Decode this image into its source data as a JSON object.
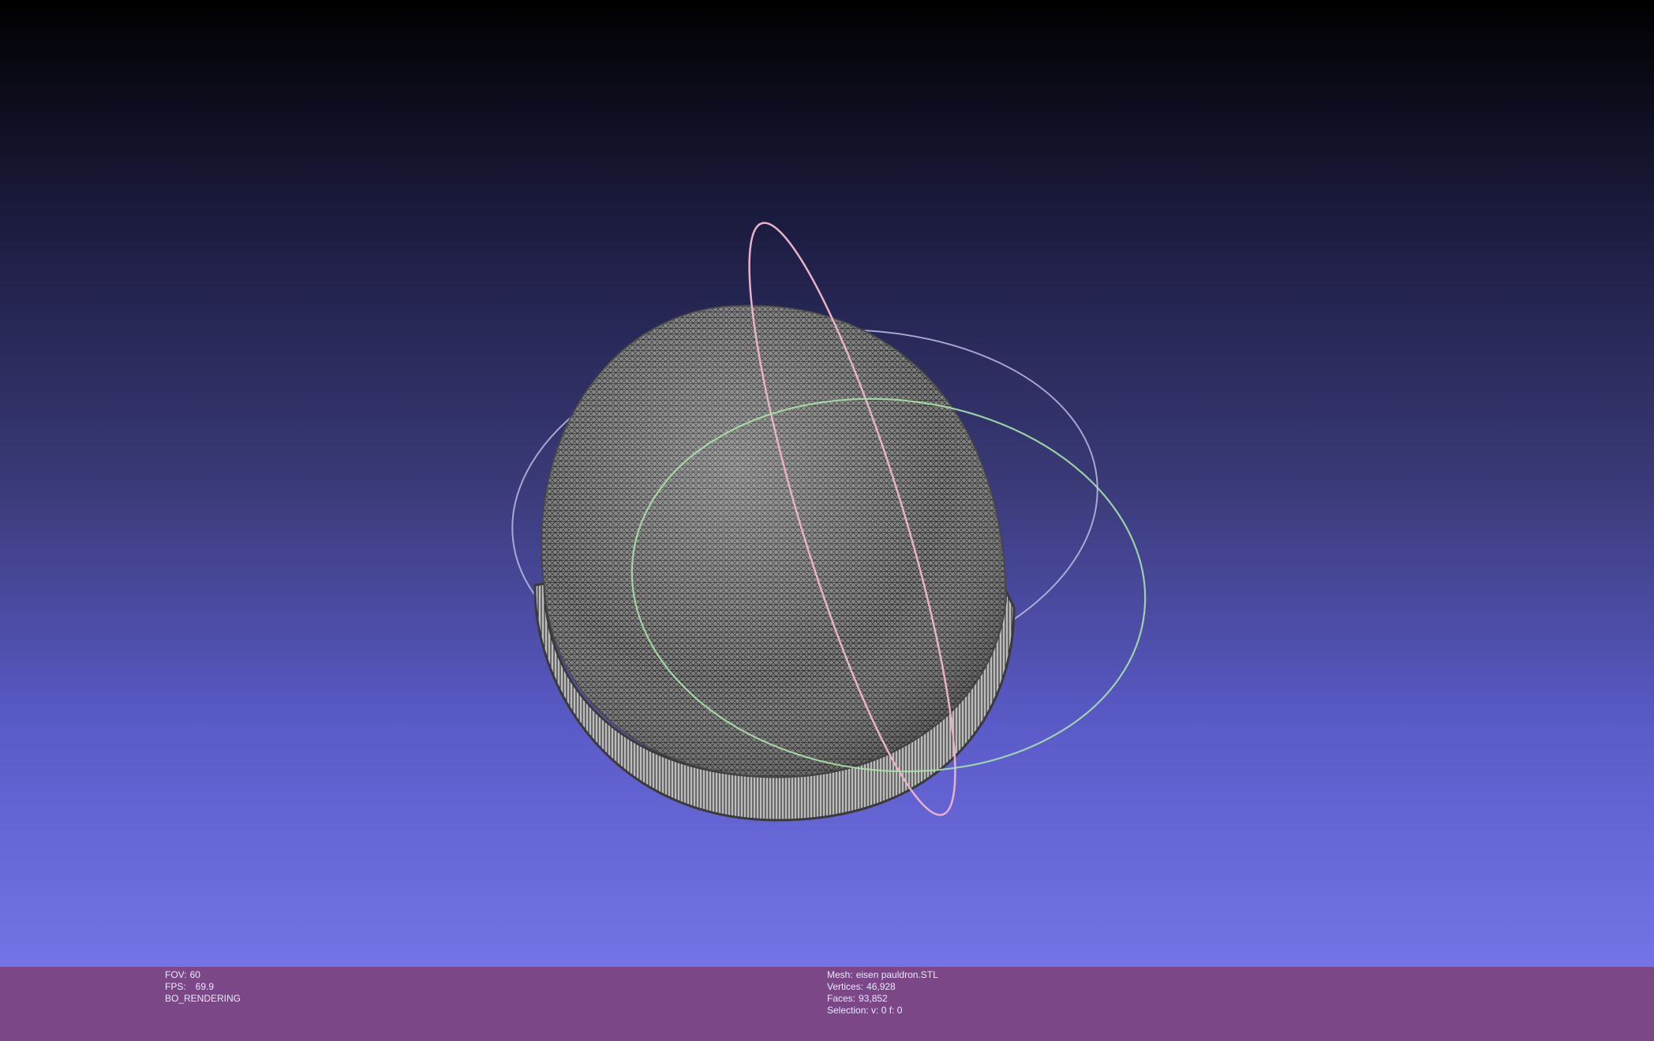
{
  "viewport": {
    "background_top": "#000000",
    "background_bottom": "#7474e8",
    "mesh_color": "#6d6d6d",
    "trackball_colors": {
      "x_ring": "#e7b2c8",
      "y_ring": "#a7e0a7",
      "z_ring": "#bdbbe0"
    }
  },
  "info_bar": {
    "color": "#7c4787",
    "left": {
      "fov_label": "FOV:",
      "fov_value": "60",
      "fps_label": "FPS:",
      "fps_value": "69.9",
      "render_mode": "BO_RENDERING"
    },
    "right": {
      "mesh_label": "Mesh:",
      "mesh_name": "eisen pauldron.STL",
      "vertices_label": "Vertices:",
      "vertices_value": "46,928",
      "faces_label": "Faces:",
      "faces_value": "93,852",
      "selection": "Selection: v: 0 f: 0"
    }
  }
}
